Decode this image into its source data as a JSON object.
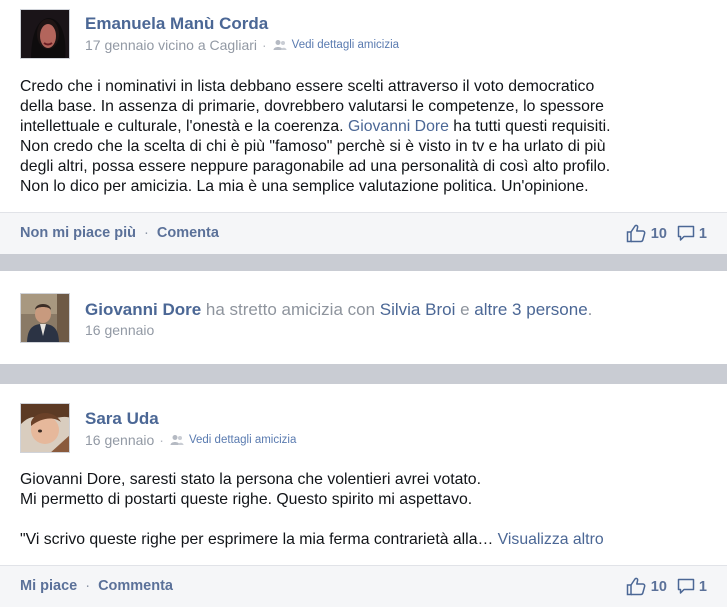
{
  "posts": [
    {
      "author": "Emanuela Manù Corda",
      "date_place": "17 gennaio vicino a Cagliari",
      "friendship_link": "Vedi dettagli amicizia",
      "lines": [
        {
          "pre": "Credo che i nominativi in lista debbano essere scelti attraverso il voto democratico"
        },
        {
          "pre": "della base. In assenza di primarie, dovrebbero valutarsi le competenze, lo spessore"
        },
        {
          "pre": "intellettuale e culturale, l'onestà e la coerenza. ",
          "link": "Giovanni Dore",
          "post": " ha tutti questi requisiti."
        },
        {
          "pre": "Non credo che la scelta di chi è più \"famoso\" perchè si è visto in tv e ha urlato di più"
        },
        {
          "pre": "degli altri, possa essere neppure paragonabile ad una personalità di così alto profilo."
        },
        {
          "pre": "Non lo dico per amicizia. La mia è una semplice valutazione politica. Un'opinione."
        }
      ],
      "like_action": "Non mi piace più",
      "comment_action": "Comenta",
      "likes": "10",
      "comments": "1"
    },
    {
      "author": "Giovanni Dore",
      "activity_mid": " ha stretto amicizia con ",
      "friend_name": "Silvia Broi",
      "activity_and": " e ",
      "others": "altre 3 persone",
      "activity_end": ".",
      "date": "16 gennaio"
    },
    {
      "author": "Sara Uda",
      "date": "16 gennaio",
      "friendship_link": "Vedi dettagli amicizia",
      "line1": "Giovanni Dore, saresti stato la persona che volentieri avrei votato.",
      "line2": "Mi permetto di postarti queste righe. Questo spirito mi aspettavo.",
      "line3": "\"Vi scrivo queste righe per esprimere la mia ferma contrarietà alla… ",
      "more": "Visualizza altro",
      "like_action": "Mi piace",
      "comment_action": "Commenta",
      "likes": "10",
      "comments": "1"
    }
  ],
  "separator": "·",
  "icons": {
    "like": "thumbs-up-icon",
    "comment": "speech-bubble-icon",
    "friend": "friends-icon"
  },
  "colors": {
    "link": "#4b6795",
    "meta": "#9299a4",
    "background": "#c9ccd3"
  }
}
